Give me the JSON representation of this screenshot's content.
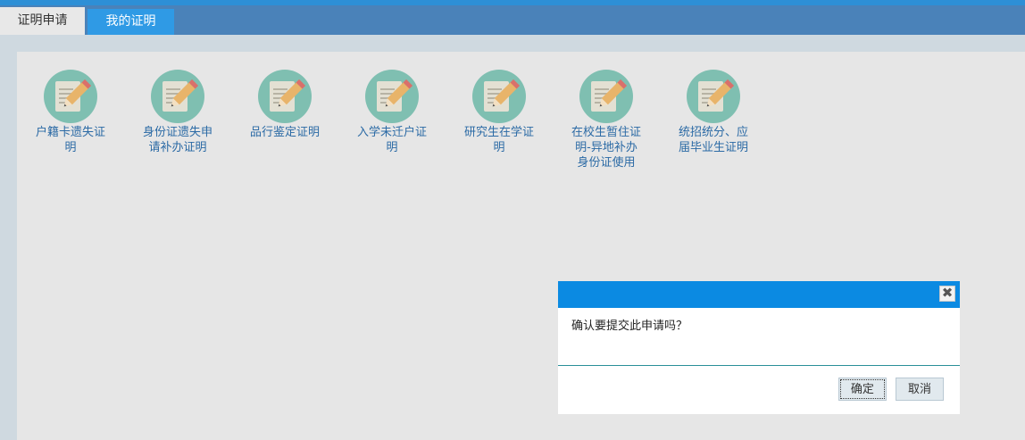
{
  "tabs": [
    {
      "label": "证明申请"
    },
    {
      "label": "我的证明"
    }
  ],
  "items": [
    {
      "label": "户籍卡遗失证明"
    },
    {
      "label": "身份证遗失申请补办证明"
    },
    {
      "label": "品行鉴定证明"
    },
    {
      "label": "入学未迁户证明"
    },
    {
      "label": "研究生在学证明"
    },
    {
      "label": "在校生暂住证明-异地补办身份证使用"
    },
    {
      "label": "统招统分、应届毕业生证明"
    }
  ],
  "dialog": {
    "close_glyph": "✖",
    "message": "确认要提交此申请吗？",
    "confirm_label": "确定",
    "cancel_label": "取消"
  },
  "colors": {
    "topbar": "#4a82b9",
    "active_tab": "#2f9ae5",
    "dialog_titlebar": "#0b8ae2",
    "item_label": "#2b6aa5",
    "icon_circle": "#7fbfb1"
  }
}
